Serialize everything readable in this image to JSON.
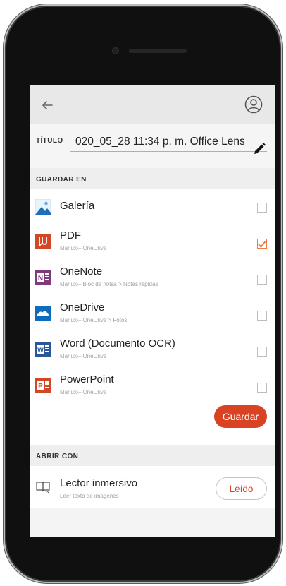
{
  "title_section": {
    "label": "TÍTULO",
    "value": "020_05_28 11:34 p. m. Office Lens"
  },
  "save_to": {
    "header": "GUARDAR EN",
    "items": [
      {
        "title": "Galería",
        "subtitle": "",
        "checked": false,
        "icon": "gallery-icon"
      },
      {
        "title": "PDF",
        "subtitle": "Mariuxi– OneDrive",
        "checked": true,
        "icon": "pdf-icon"
      },
      {
        "title": "OneNote",
        "subtitle": "Mariuxi– Bloc de notas > Notas rápidas",
        "checked": false,
        "icon": "onenote-icon"
      },
      {
        "title": "OneDrive",
        "subtitle": "Mariuxi– OneDrive > Fotos",
        "checked": false,
        "icon": "onedrive-icon"
      },
      {
        "title": "Word (Documento OCR)",
        "subtitle": "Mariuxi– OneDrive",
        "checked": false,
        "icon": "word-icon"
      },
      {
        "title": "PowerPoint",
        "subtitle": "Mariuxi– OneDrive",
        "checked": false,
        "icon": "powerpoint-icon"
      }
    ],
    "save_label": "Guardar"
  },
  "open_with": {
    "header": "ABRIR CON",
    "item": {
      "title": "Lector inmersivo",
      "subtitle": "Leer texto de imágenes",
      "icon": "immersive-reader-icon"
    },
    "button_label": "Leído"
  },
  "colors": {
    "accent": "#d94324",
    "check": "#ee7a45",
    "pdf": "#d24726",
    "onenote": "#80397b",
    "onedrive": "#0f6cbd",
    "word": "#2b579a",
    "powerpoint": "#d24726"
  }
}
